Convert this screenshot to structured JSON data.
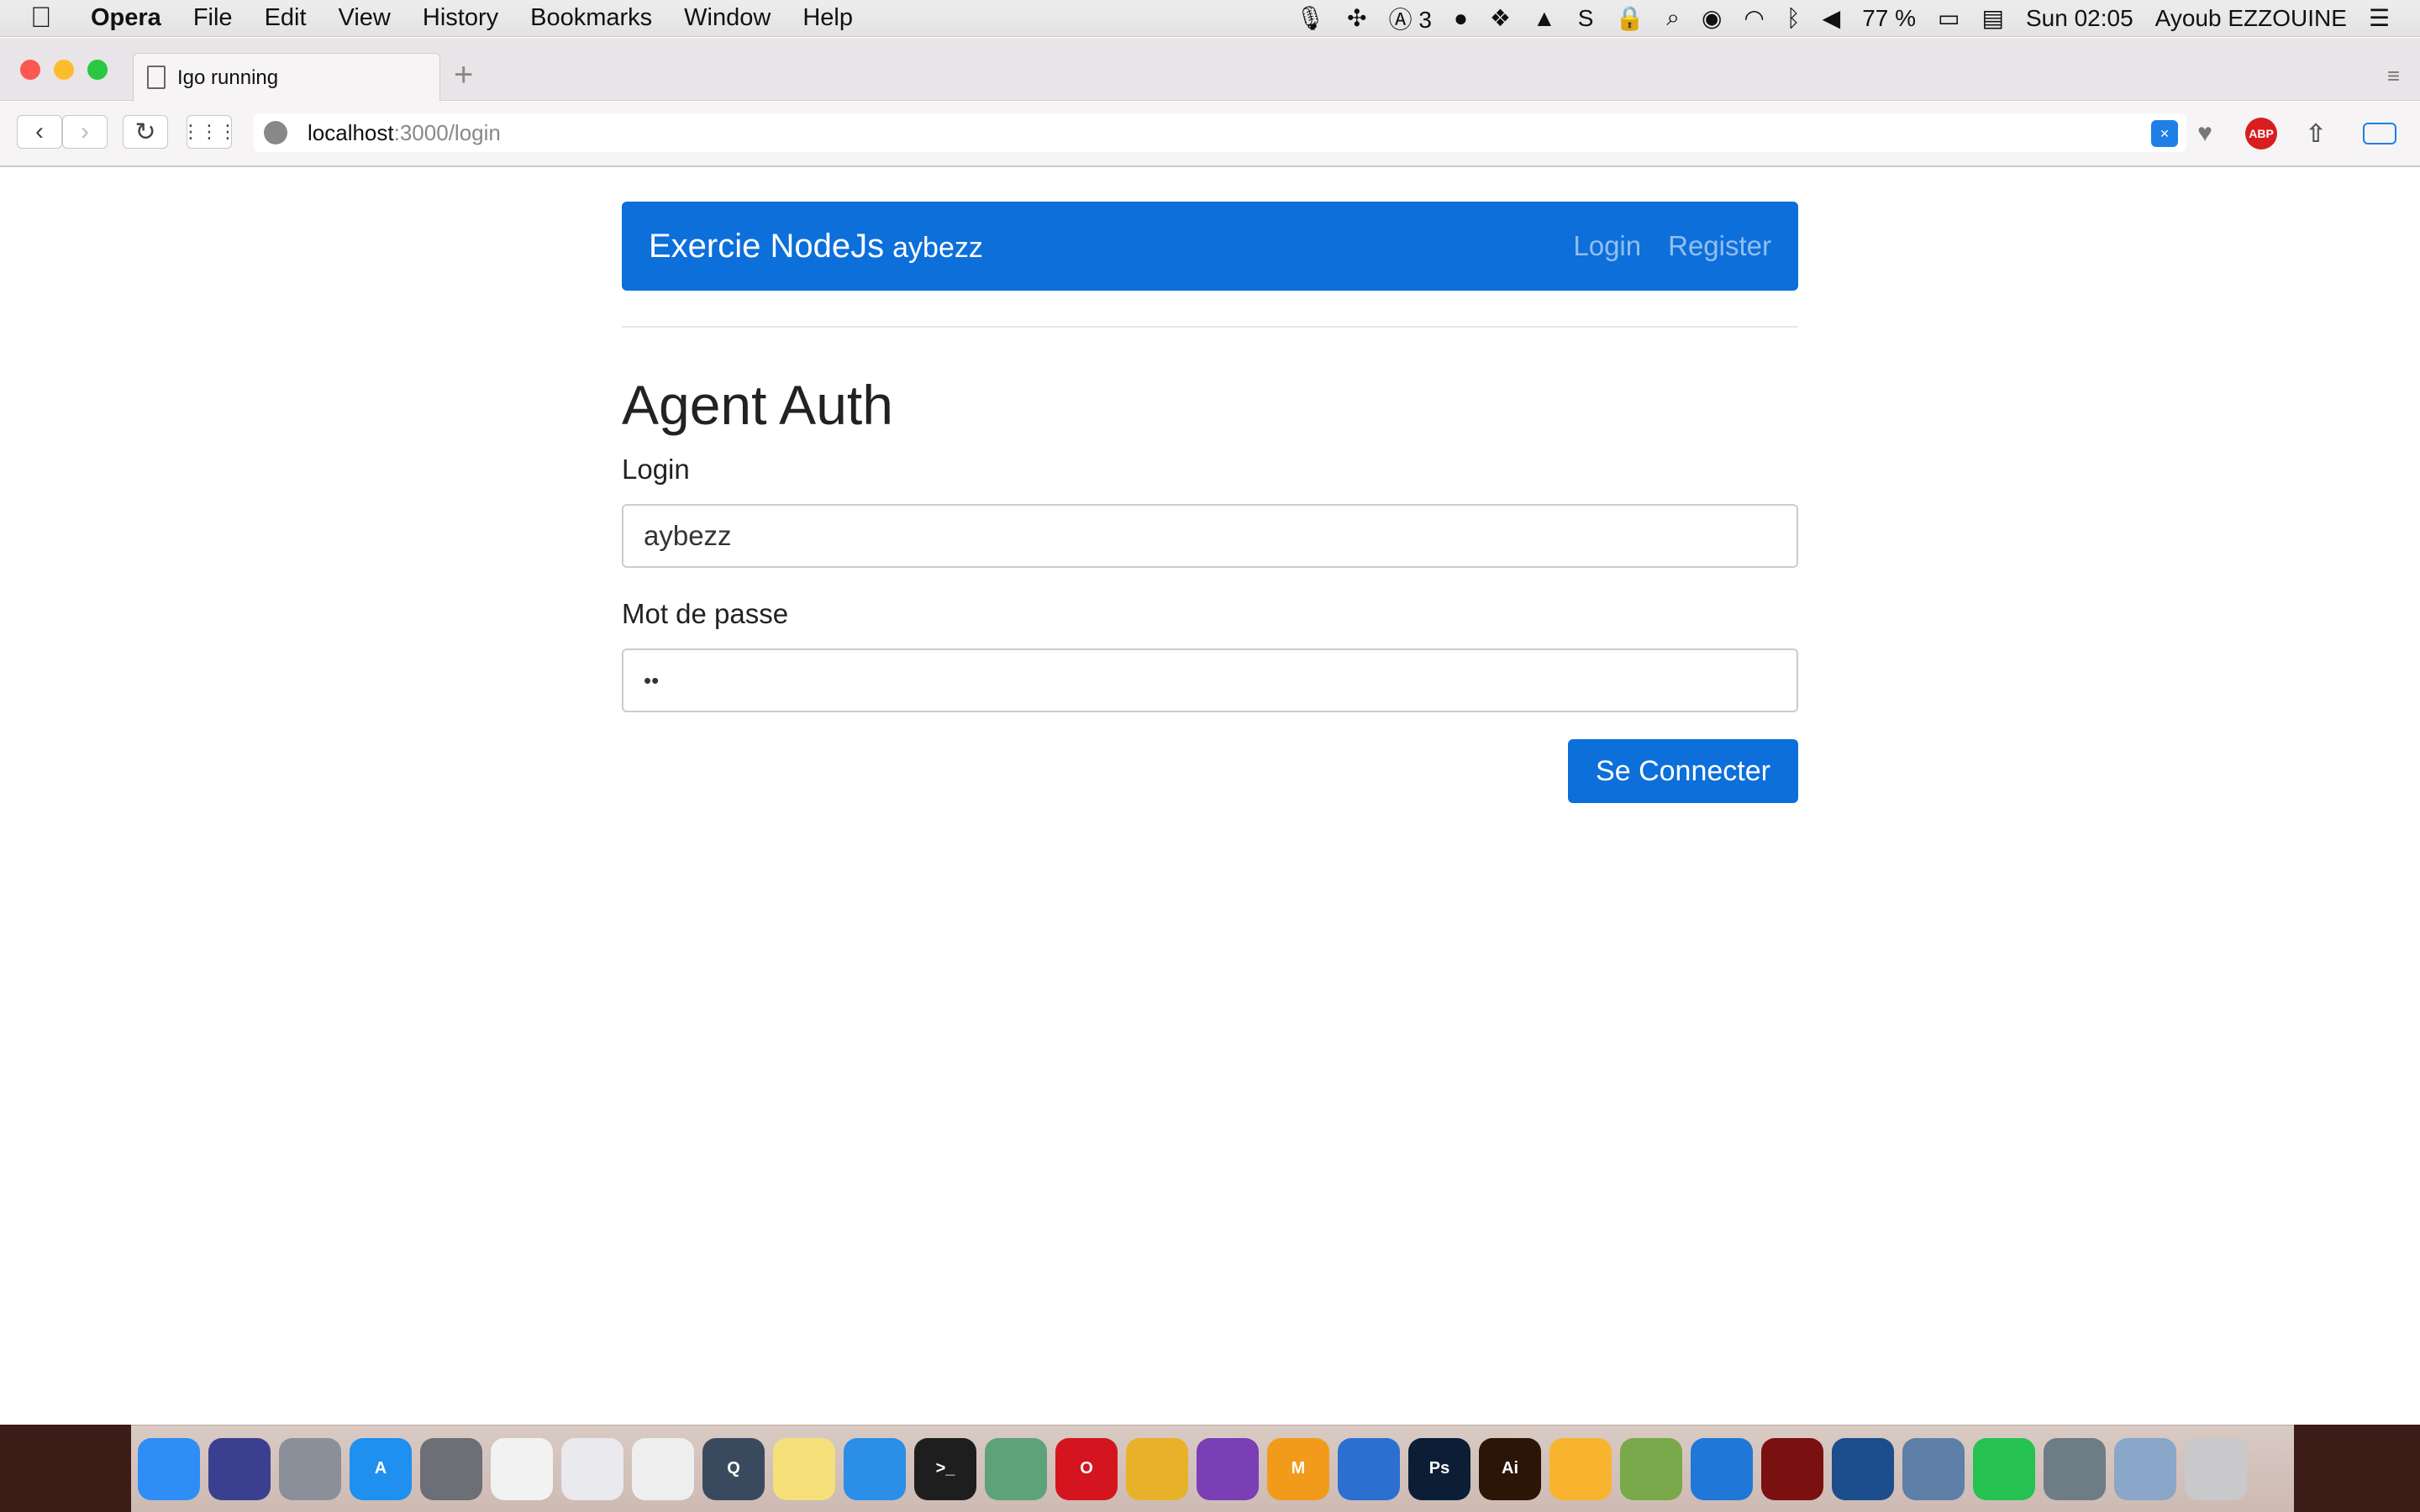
{
  "menubar": {
    "app_name": "Opera",
    "items": [
      "File",
      "Edit",
      "View",
      "History",
      "Bookmarks",
      "Window",
      "Help"
    ],
    "status_number": "3",
    "battery": "77 %",
    "clock": "Sun 02:05",
    "user": "Ayoub EZZOUINE"
  },
  "browser": {
    "tab_title": "Igo running",
    "url_host": "localhost",
    "url_path": ":3000/login",
    "ext_abp": "ABP"
  },
  "page": {
    "brand": "Exercie NodeJs",
    "brand_user": "aybezz",
    "nav_login": "Login",
    "nav_register": "Register",
    "title": "Agent Auth",
    "login_label": "Login",
    "login_value": "aybezz",
    "password_label": "Mot de passe",
    "password_value": "••",
    "submit": "Se Connecter"
  },
  "dock": {
    "icons": [
      {
        "name": "finder-icon",
        "color": "#2f8ef5",
        "text": ""
      },
      {
        "name": "siri-icon",
        "color": "#3b3f8f",
        "text": ""
      },
      {
        "name": "launchpad-icon",
        "color": "#8a8f99",
        "text": ""
      },
      {
        "name": "app-store-icon",
        "color": "#1f8ff0",
        "text": "A"
      },
      {
        "name": "system-preferences-icon",
        "color": "#6c6f75",
        "text": ""
      },
      {
        "name": "grid-app-icon",
        "color": "#f2f2f2",
        "text": ""
      },
      {
        "name": "itunes-icon",
        "color": "#e9e9ee",
        "text": ""
      },
      {
        "name": "textedit-icon",
        "color": "#eeeeee",
        "text": ""
      },
      {
        "name": "quicktime-icon",
        "color": "#3a4a5e",
        "text": "Q"
      },
      {
        "name": "notes-icon",
        "color": "#f5e07a",
        "text": ""
      },
      {
        "name": "safari-icon",
        "color": "#2b8ee8",
        "text": ""
      },
      {
        "name": "terminal-icon",
        "color": "#1e1e1e",
        "text": ">_"
      },
      {
        "name": "atom-icon",
        "color": "#5ea27a",
        "text": ""
      },
      {
        "name": "opera-icon",
        "color": "#d4151f",
        "text": "O"
      },
      {
        "name": "chrome-icon",
        "color": "#e8b12a",
        "text": ""
      },
      {
        "name": "compass-icon",
        "color": "#7a3fb5",
        "text": ""
      },
      {
        "name": "mr-app-icon",
        "color": "#f29b1a",
        "text": "M"
      },
      {
        "name": "bracket-app-icon",
        "color": "#2b6fd1",
        "text": ""
      },
      {
        "name": "photoshop-icon",
        "color": "#0b1e36",
        "text": "Ps"
      },
      {
        "name": "illustrator-icon",
        "color": "#2b1506",
        "text": "Ai"
      },
      {
        "name": "sketch-icon",
        "color": "#f8b42f",
        "text": ""
      },
      {
        "name": "android-studio-icon",
        "color": "#79a94a",
        "text": ""
      },
      {
        "name": "teamviewer-icon",
        "color": "#1f78d8",
        "text": ""
      },
      {
        "name": "acrobat-icon",
        "color": "#7a1010",
        "text": ""
      },
      {
        "name": "virtualbox-icon",
        "color": "#1c4d8c",
        "text": ""
      },
      {
        "name": "preview-icon",
        "color": "#5d7fa8",
        "text": ""
      },
      {
        "name": "whatsapp-icon",
        "color": "#25c252",
        "text": ""
      },
      {
        "name": "sequel-icon",
        "color": "#6e7c85",
        "text": ""
      },
      {
        "name": "image-app-icon",
        "color": "#8aa6c8",
        "text": ""
      },
      {
        "name": "trash-icon",
        "color": "#c9c9cc",
        "text": ""
      }
    ]
  }
}
